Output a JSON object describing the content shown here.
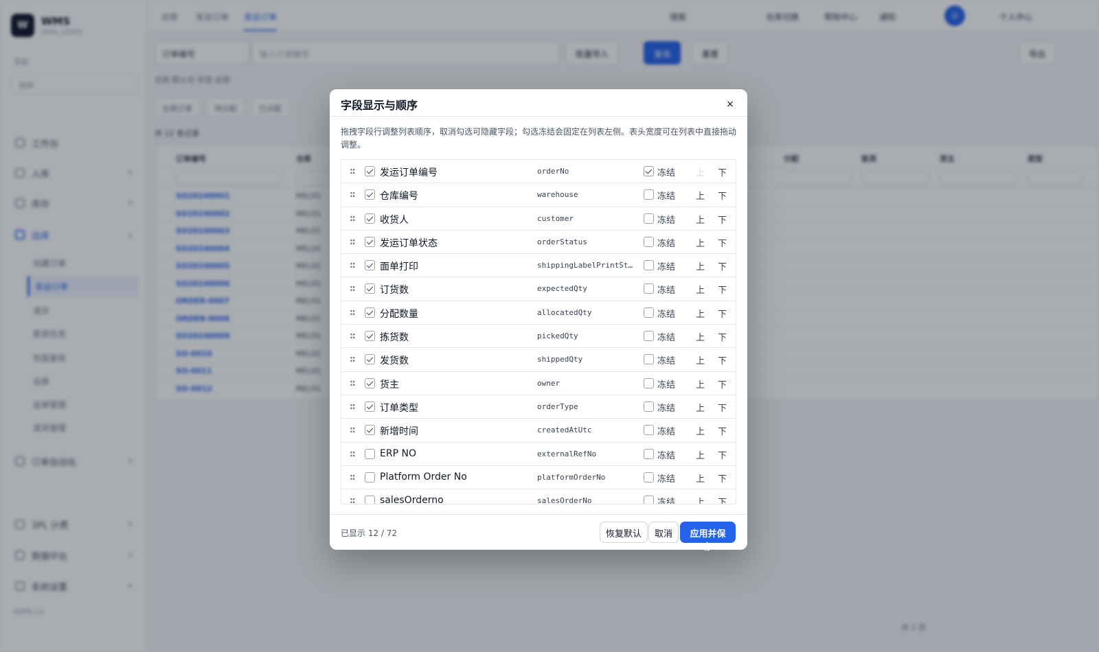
{
  "background": {
    "logo_mark": "W",
    "app_name": "WMS",
    "app_subtitle": "WMS_DEMO",
    "sidebar_caption": "导航",
    "sidebar_search": "搜索",
    "sidebar_items": [
      {
        "label": "工作台"
      },
      {
        "label": "入库"
      },
      {
        "label": "库存"
      },
      {
        "label": "出库"
      }
    ],
    "sidebar_sub_items": [
      "创建订单",
      "发运订单",
      "波次",
      "拣货任务",
      "包装复核",
      "出库",
      "运单管理",
      "退货管理"
    ],
    "sidebar_bottom_items": [
      {
        "label": "订单自动化"
      },
      {
        "label": "3PL 计费"
      },
      {
        "label": "数据中台"
      },
      {
        "label": "系统设置"
      }
    ],
    "sidebar_footer": "WMS v1",
    "breadcrumbs": [
      "出库",
      "发运订单",
      "发运订单"
    ],
    "top_right": [
      "搜索",
      "仓库切换",
      "帮助中心",
      "通知",
      "个人中心"
    ],
    "filter_select": "订单编号",
    "filter_input_placeholder": "输入订单编号",
    "filter_buttons": [
      "批量导入",
      "查询",
      "重置"
    ],
    "export_label": "导出",
    "chips": "仓库:默认仓  状态:全部",
    "tabs": [
      "全部订单",
      "待分配",
      "已分配"
    ],
    "summary": "共 12 条记录",
    "table_headers": [
      "订单编号",
      "仓库",
      "收货人",
      "状态",
      "打印",
      "订货数",
      "分配",
      "拣货",
      "发货",
      "货主",
      "类型"
    ],
    "table_rows": [
      [
        "SO20240001",
        "MEL01"
      ],
      [
        "SO20240002",
        "MEL01"
      ],
      [
        "SO20240003",
        "MEL01"
      ],
      [
        "SO20240004",
        "MEL01"
      ],
      [
        "SO20240005",
        "MEL01"
      ],
      [
        "SO20240006",
        "MEL01"
      ],
      [
        "ORDER-0007",
        "MEL01"
      ],
      [
        "ORDER-0008",
        "MEL01"
      ],
      [
        "SO20240009",
        "MEL01"
      ],
      [
        "SO-0010",
        "MEL01"
      ],
      [
        "SO-0011",
        "MEL01"
      ],
      [
        "SO-0012",
        "MEL01"
      ]
    ],
    "pager": "共 1 页"
  },
  "modal": {
    "title": "字段显示与顺序",
    "close_glyph": "×",
    "description": "拖拽字段行调整列表顺序，取消勾选可隐藏字段；勾选冻结会固定在列表左侧。表头宽度可在列表中直接拖动调整。",
    "drag_glyph": "::",
    "freeze_label": "冻结",
    "up_label": "上",
    "down_label": "下",
    "fields": [
      {
        "label": "发运订单编号",
        "key": "orderNo",
        "visible": true,
        "frozen": true,
        "up_disabled": true
      },
      {
        "label": "仓库编号",
        "key": "warehouse",
        "visible": true,
        "frozen": false,
        "up_disabled": false
      },
      {
        "label": "收货人",
        "key": "customer",
        "visible": true,
        "frozen": false,
        "up_disabled": false
      },
      {
        "label": "发运订单状态",
        "key": "orderStatus",
        "visible": true,
        "frozen": false,
        "up_disabled": false
      },
      {
        "label": "面单打印",
        "key": "shippingLabelPrintStatus",
        "visible": true,
        "frozen": false,
        "up_disabled": false
      },
      {
        "label": "订货数",
        "key": "expectedQty",
        "visible": true,
        "frozen": false,
        "up_disabled": false
      },
      {
        "label": "分配数量",
        "key": "allocatedQty",
        "visible": true,
        "frozen": false,
        "up_disabled": false
      },
      {
        "label": "拣货数",
        "key": "pickedQty",
        "visible": true,
        "frozen": false,
        "up_disabled": false
      },
      {
        "label": "发货数",
        "key": "shippedQty",
        "visible": true,
        "frozen": false,
        "up_disabled": false
      },
      {
        "label": "货主",
        "key": "owner",
        "visible": true,
        "frozen": false,
        "up_disabled": false
      },
      {
        "label": "订单类型",
        "key": "orderType",
        "visible": true,
        "frozen": false,
        "up_disabled": false
      },
      {
        "label": "新增时间",
        "key": "createdAtUtc",
        "visible": true,
        "frozen": false,
        "up_disabled": false
      },
      {
        "label": "ERP NO",
        "key": "externalRefNo",
        "visible": false,
        "frozen": false,
        "up_disabled": false
      },
      {
        "label": "Platform Order No",
        "key": "platformOrderNo",
        "visible": false,
        "frozen": false,
        "up_disabled": false
      },
      {
        "label": "salesOrderno",
        "key": "salesOrderNo",
        "visible": false,
        "frozen": false,
        "up_disabled": false
      }
    ],
    "count_text": "已显示 12 / 72",
    "reset_label": "恢复默认",
    "cancel_label": "取消",
    "save_label": "应用并保存"
  },
  "colors": {
    "accent": "#2563eb",
    "overlay": "rgba(17,24,39,0.36)"
  }
}
